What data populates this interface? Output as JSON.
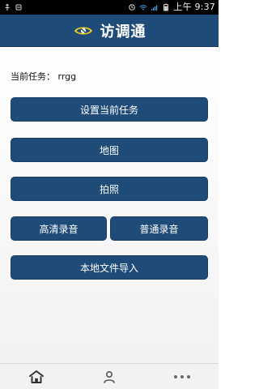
{
  "status_bar": {
    "time": "上午 9:37",
    "icons": [
      "usb-icon",
      "usb-debug-icon",
      "alarm-icon",
      "wifi-icon",
      "signal-icon",
      "battery-icon"
    ]
  },
  "header": {
    "title": "访调通",
    "logo_icon": "eye-logo-icon",
    "bg_color": "#1f4b79",
    "accent_color": "#f1d21a"
  },
  "content": {
    "current_task_label": "当前任务：",
    "current_task_value": "rrgg",
    "buttons": {
      "set_task": "设置当前任务",
      "map": "地图",
      "photo": "拍照",
      "hd_recording": "高清录音",
      "normal_recording": "普通录音",
      "import_local": "本地文件导入"
    }
  },
  "bottom_nav": {
    "items": [
      {
        "icon": "home-icon"
      },
      {
        "icon": "user-icon"
      },
      {
        "icon": "more-icon"
      }
    ]
  }
}
